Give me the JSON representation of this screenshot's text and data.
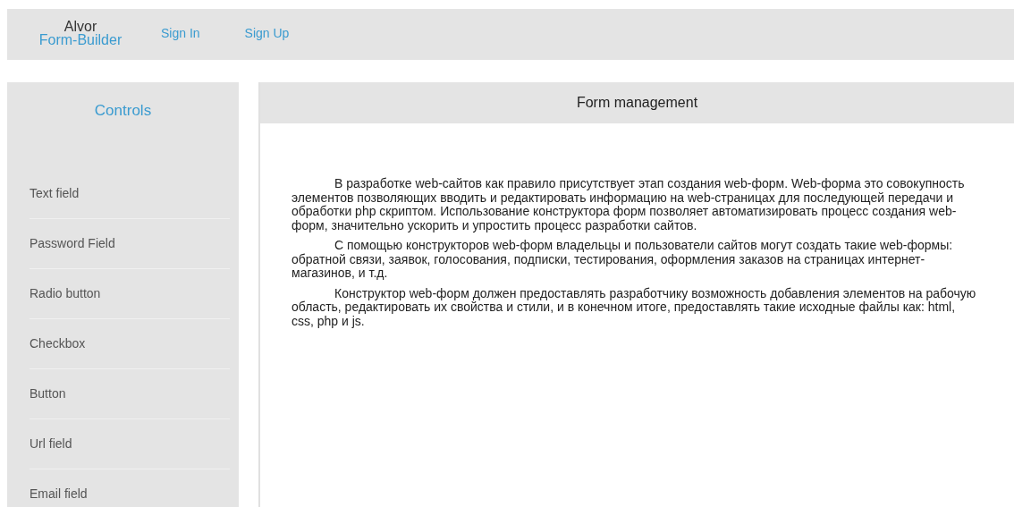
{
  "header": {
    "logo_top": "Alvor",
    "logo_bottom": "Form-Builder",
    "links": [
      "Sign In",
      "Sign Up"
    ]
  },
  "sidebar": {
    "title": "Controls",
    "items": [
      "Text field",
      "Password Field",
      "Radio button",
      "Checkbox",
      "Button",
      "Url field",
      "Email field"
    ]
  },
  "main": {
    "title": "Form management",
    "paragraphs": [
      "В разработке web-сайтов как правило присутствует этап создания web-форм. Web-форма это совокупность элементов позволяющих вводить и редактировать информацию на web-страницах для последующей передачи и обработки php скриптом. Использование конструктора форм позволяет автоматизировать процесс создания web-форм, значительно ускорить и упростить процесс разработки сайтов.",
      "С помощью конструкторов web-форм владельцы и пользователи сайтов могут создать такие web-формы: обратной связи, заявок, голосования, подписки, тестирования, оформления заказов на страницах интернет-магазинов, и т.д.",
      "Конструктор web-форм должен предоставлять разработчику возможность добавления элементов на рабочую область, редактировать их свойства и стили, и в конечном итоге, предоставлять такие исходные файлы как: html, css, php и js."
    ]
  }
}
